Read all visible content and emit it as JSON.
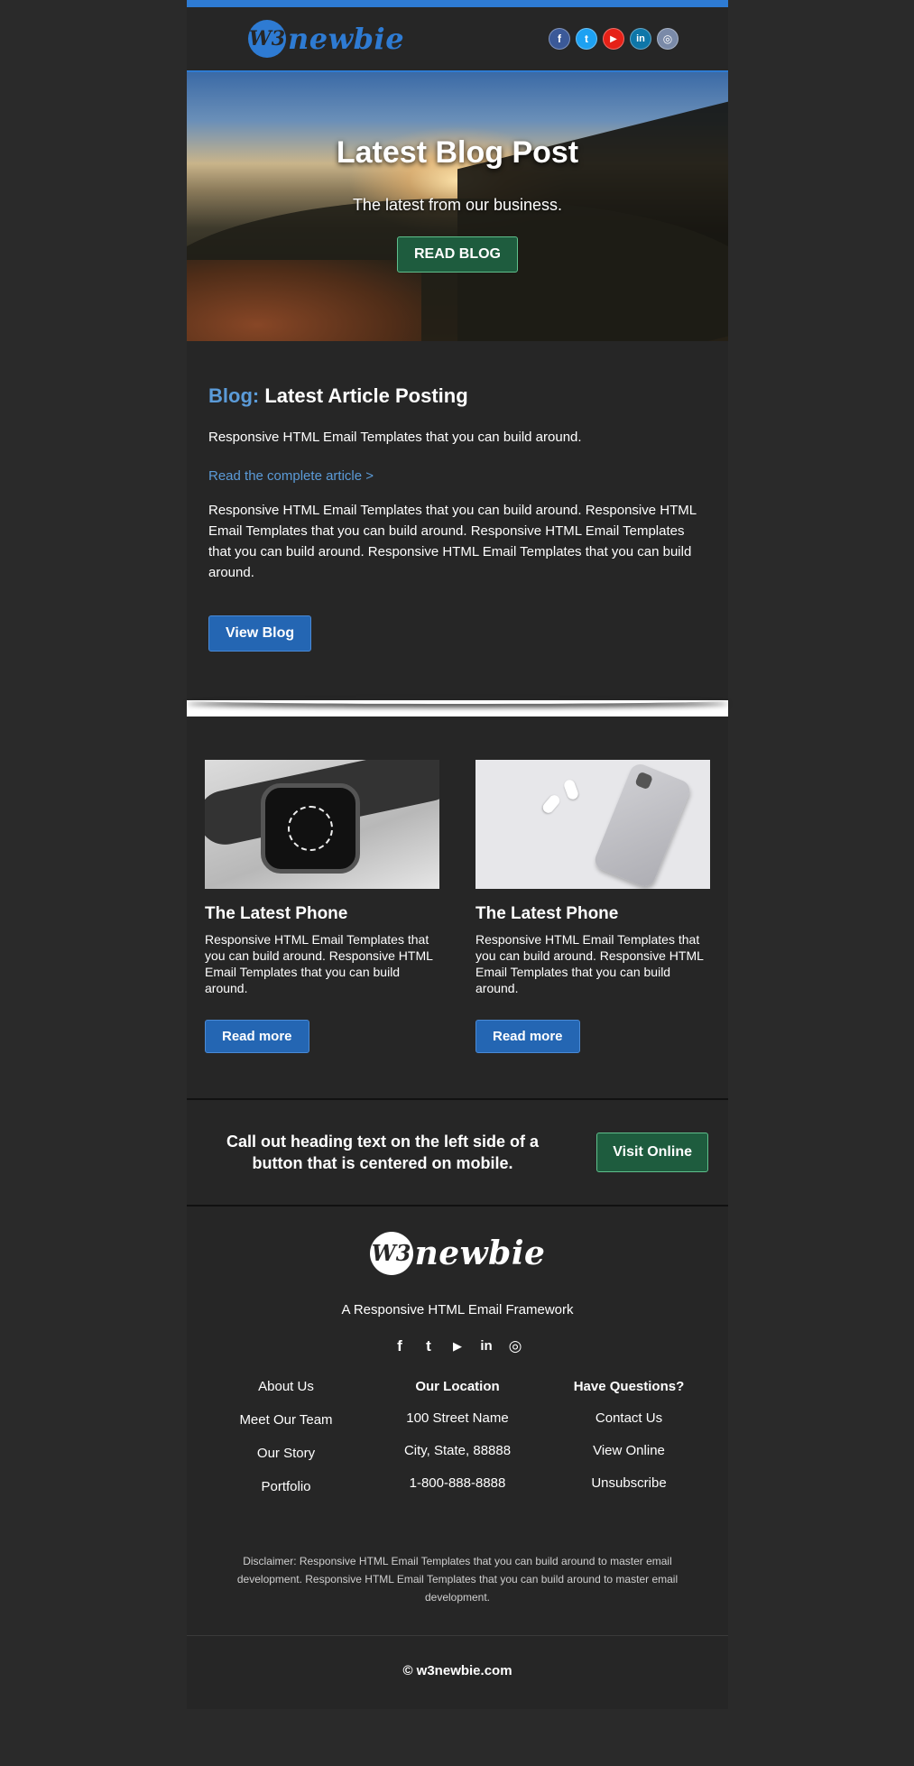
{
  "header": {
    "logo_mark": "W3",
    "logo_word": "newbie",
    "social": [
      {
        "icon": "facebook-icon",
        "glyph": "f",
        "color": "#3b5998"
      },
      {
        "icon": "twitter-icon",
        "glyph": "t",
        "color": "#1da1f2"
      },
      {
        "icon": "youtube-icon",
        "glyph": "▶",
        "color": "#e62117"
      },
      {
        "icon": "linkedin-icon",
        "glyph": "in",
        "color": "#0e76a8"
      },
      {
        "icon": "instagram-icon",
        "glyph": "◎",
        "color": "#7a8aa8"
      }
    ]
  },
  "hero": {
    "title": "Latest Blog Post",
    "subtitle": "The latest from our business.",
    "button": "READ BLOG"
  },
  "blog": {
    "accent": "Blog:",
    "title": "Latest Article Posting",
    "intro": "Responsive HTML Email Templates that you can build around.",
    "link": "Read the complete article >",
    "body": "Responsive HTML Email Templates that you can build around. Responsive HTML Email Templates that you can build around. Responsive HTML Email Templates that you can build around. Responsive HTML Email Templates that you can build around.",
    "button": "View Blog"
  },
  "products": [
    {
      "title": "The Latest Phone",
      "text": "Responsive HTML Email Templates that you can build around. Responsive HTML Email Templates that you can build around.",
      "button": "Read more"
    },
    {
      "title": "The Latest Phone",
      "text": "Responsive HTML Email Templates that you can build around. Responsive HTML Email Templates that you can build around.",
      "button": "Read more"
    }
  ],
  "callout": {
    "text": "Call out heading text on the left side of a button that is centered on mobile.",
    "button": "Visit Online"
  },
  "footer": {
    "logo_mark": "W3",
    "logo_word": "newbie",
    "tagline": "A Responsive HTML Email Framework",
    "social_glyphs": {
      "facebook": "f",
      "twitter": "t",
      "youtube": "▶",
      "linkedin": "in",
      "instagram": "◎"
    },
    "col_left": [
      "About Us",
      "Meet Our Team",
      "Our Story",
      "Portfolio"
    ],
    "col_mid": {
      "head": "Our Location",
      "items": [
        "100 Street Name",
        "City, State, 88888",
        "1-800-888-8888"
      ]
    },
    "col_right": {
      "head": "Have Questions?",
      "items": [
        "Contact Us",
        "View Online",
        "Unsubscribe"
      ]
    },
    "disclaimer": "Disclaimer: Responsive HTML Email Templates that you can build around to master email development. Responsive HTML Email Templates that you can build around to master email development.",
    "copyright": "© w3newbie.com"
  },
  "colors": {
    "accent_blue": "#2e7bd3",
    "link_blue": "#5b9bd8",
    "button_blue": "#2466b3",
    "button_green": "#1e5c3e",
    "background": "#2a2a2a",
    "panel": "#262626"
  }
}
